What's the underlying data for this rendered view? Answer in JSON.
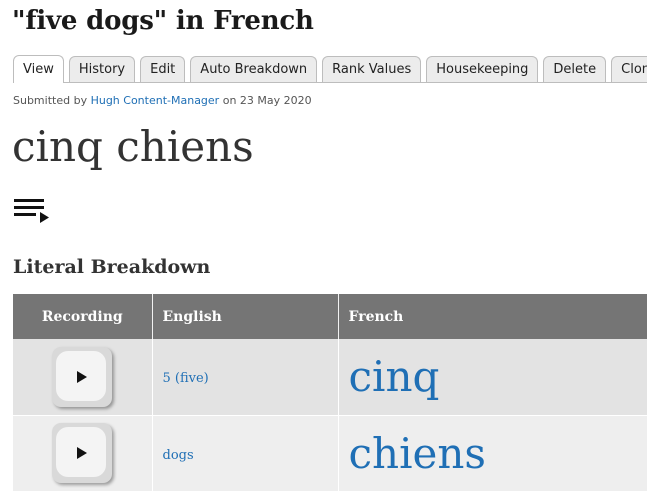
{
  "page": {
    "title": "\"five dogs\" in French"
  },
  "tabs": [
    {
      "label": "View",
      "active": true
    },
    {
      "label": "History"
    },
    {
      "label": "Edit"
    },
    {
      "label": "Auto Breakdown"
    },
    {
      "label": "Rank Values"
    },
    {
      "label": "Housekeeping"
    },
    {
      "label": "Delete"
    },
    {
      "label": "Clone"
    }
  ],
  "submitted": {
    "prefix": "Submitted by",
    "author": "Hugh Content-Manager",
    "date_text": "on 23 May 2020"
  },
  "headword": "cinq chiens",
  "play_all_icon": "playlist-play-icon",
  "breakdown": {
    "title": "Literal Breakdown",
    "columns": [
      "Recording",
      "English",
      "French"
    ],
    "rows": [
      {
        "recording_icon": "play-icon",
        "english": "5 (five)",
        "french": "cinq"
      },
      {
        "recording_icon": "play-icon",
        "english": "dogs",
        "french": "chiens"
      }
    ]
  },
  "colors": {
    "link": "#1f6fb5",
    "table_header": "#757575",
    "row_odd": "#e3e3e3",
    "row_even": "#eeeeee"
  }
}
